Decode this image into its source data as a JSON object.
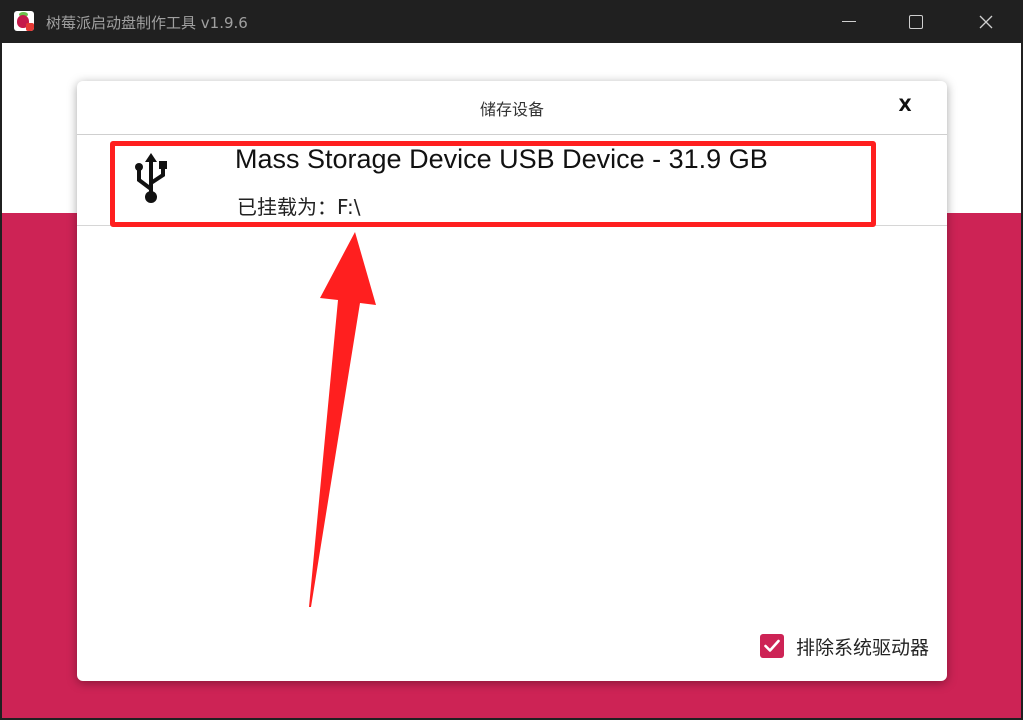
{
  "window": {
    "title": "树莓派启动盘制作工具 v1.9.6",
    "icon": "raspberry-pi-icon",
    "controls": [
      "minimize-icon",
      "maximize-icon",
      "close-icon"
    ]
  },
  "dialog": {
    "title": "储存设备",
    "close_label": "X",
    "devices": [
      {
        "icon": "usb-icon",
        "name": "Mass Storage Device USB Device - 31.9 GB",
        "mount": "已挂载为：F:\\"
      }
    ],
    "exclude_system_drives": {
      "label": "排除系统驱动器",
      "checked": true
    }
  },
  "colors": {
    "accent": "#cd2355",
    "annotation": "#ff1f1f",
    "titlebar": "#202020"
  }
}
